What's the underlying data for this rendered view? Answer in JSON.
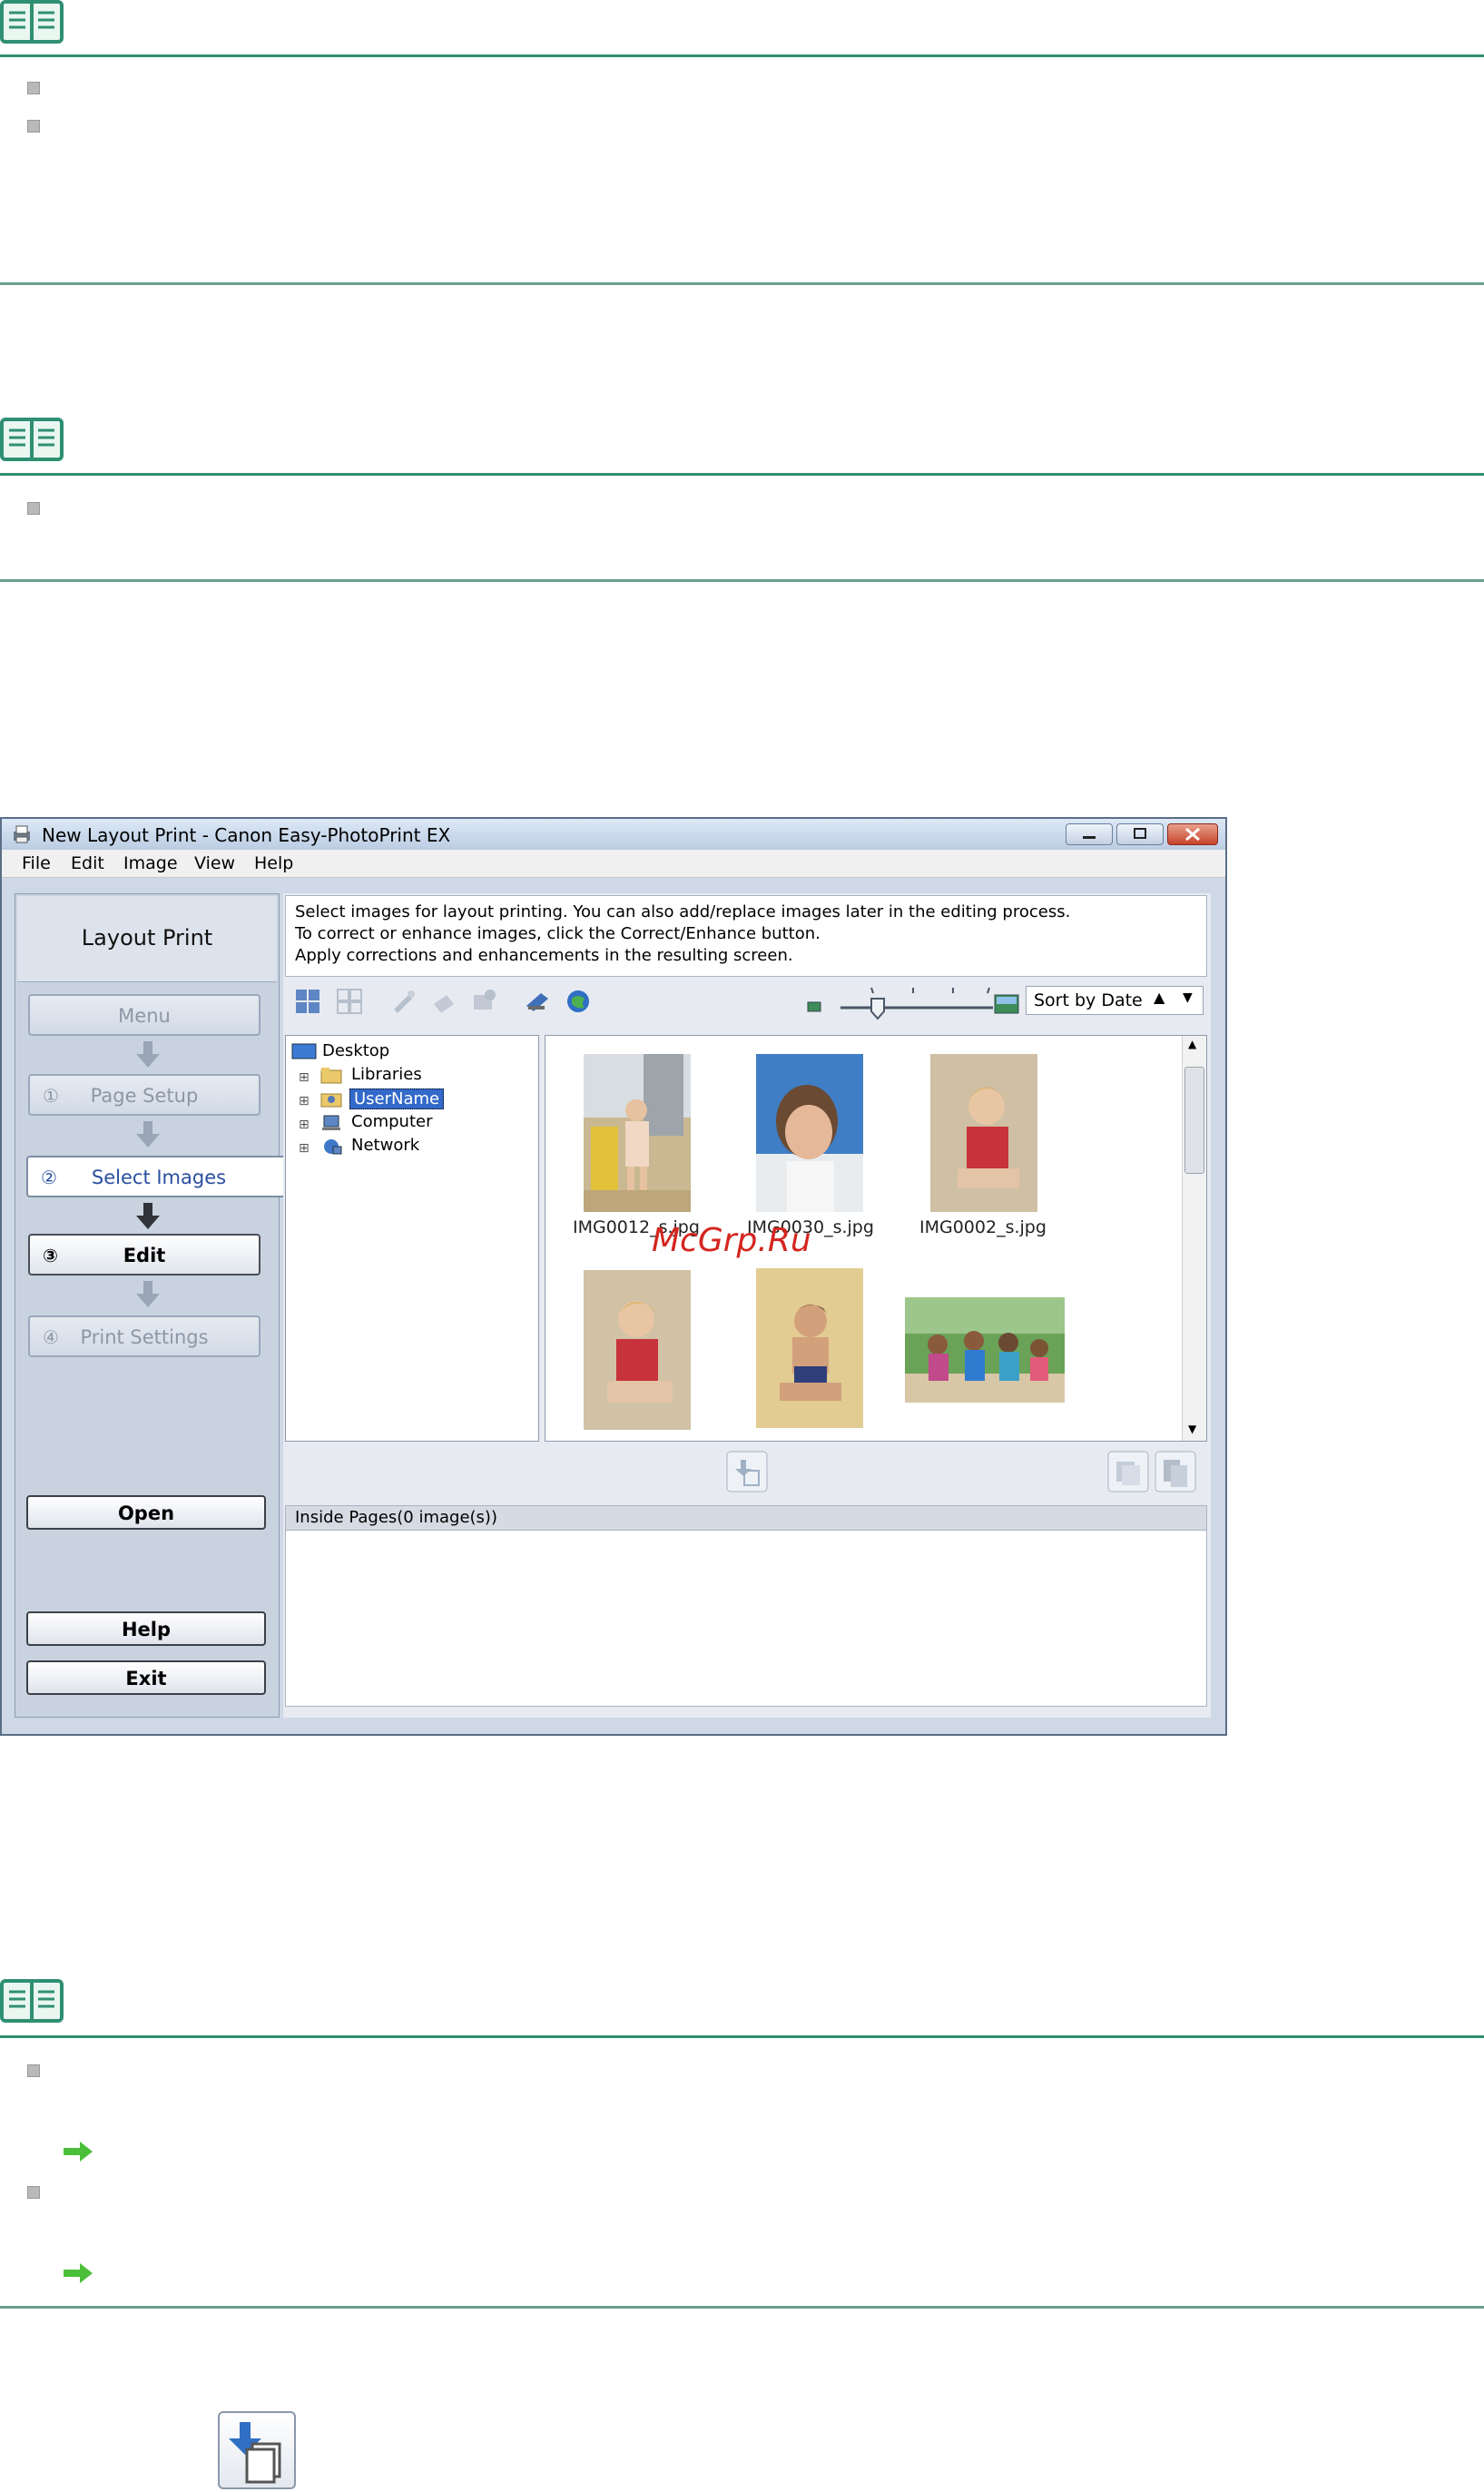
{
  "window": {
    "title": "New Layout Print - Canon Easy-PhotoPrint EX",
    "menu": [
      "File",
      "Edit",
      "Image",
      "View",
      "Help"
    ]
  },
  "left_panel": {
    "title": "Layout Print",
    "menu_button": "Menu",
    "steps": [
      {
        "num": "①",
        "label": "Page Setup"
      },
      {
        "num": "②",
        "label": "Select Images"
      },
      {
        "num": "③",
        "label": "Edit"
      },
      {
        "num": "④",
        "label": "Print Settings"
      }
    ],
    "open_button": "Open",
    "help_button": "Help",
    "exit_button": "Exit"
  },
  "instructions": [
    "Select images for layout printing. You can also add/replace images later in the editing process.",
    "To correct or enhance images, click the Correct/Enhance button.",
    "Apply corrections and enhancements in the resulting screen."
  ],
  "sort_select": "Sort by Date",
  "tree": [
    "Desktop",
    "Libraries",
    "UserName",
    "Computer",
    "Network"
  ],
  "thumbnails": [
    "IMG0012_s.jpg",
    "IMG0030_s.jpg",
    "IMG0002_s.jpg"
  ],
  "inside_pages": "Inside Pages(0 image(s))",
  "watermark": "McGrp.Ru",
  "colors": {
    "rule": "#2f8f73",
    "selected_tree": "#3369c9",
    "active_step_text": "#2a4fa0",
    "watermark": "#d4251f"
  }
}
